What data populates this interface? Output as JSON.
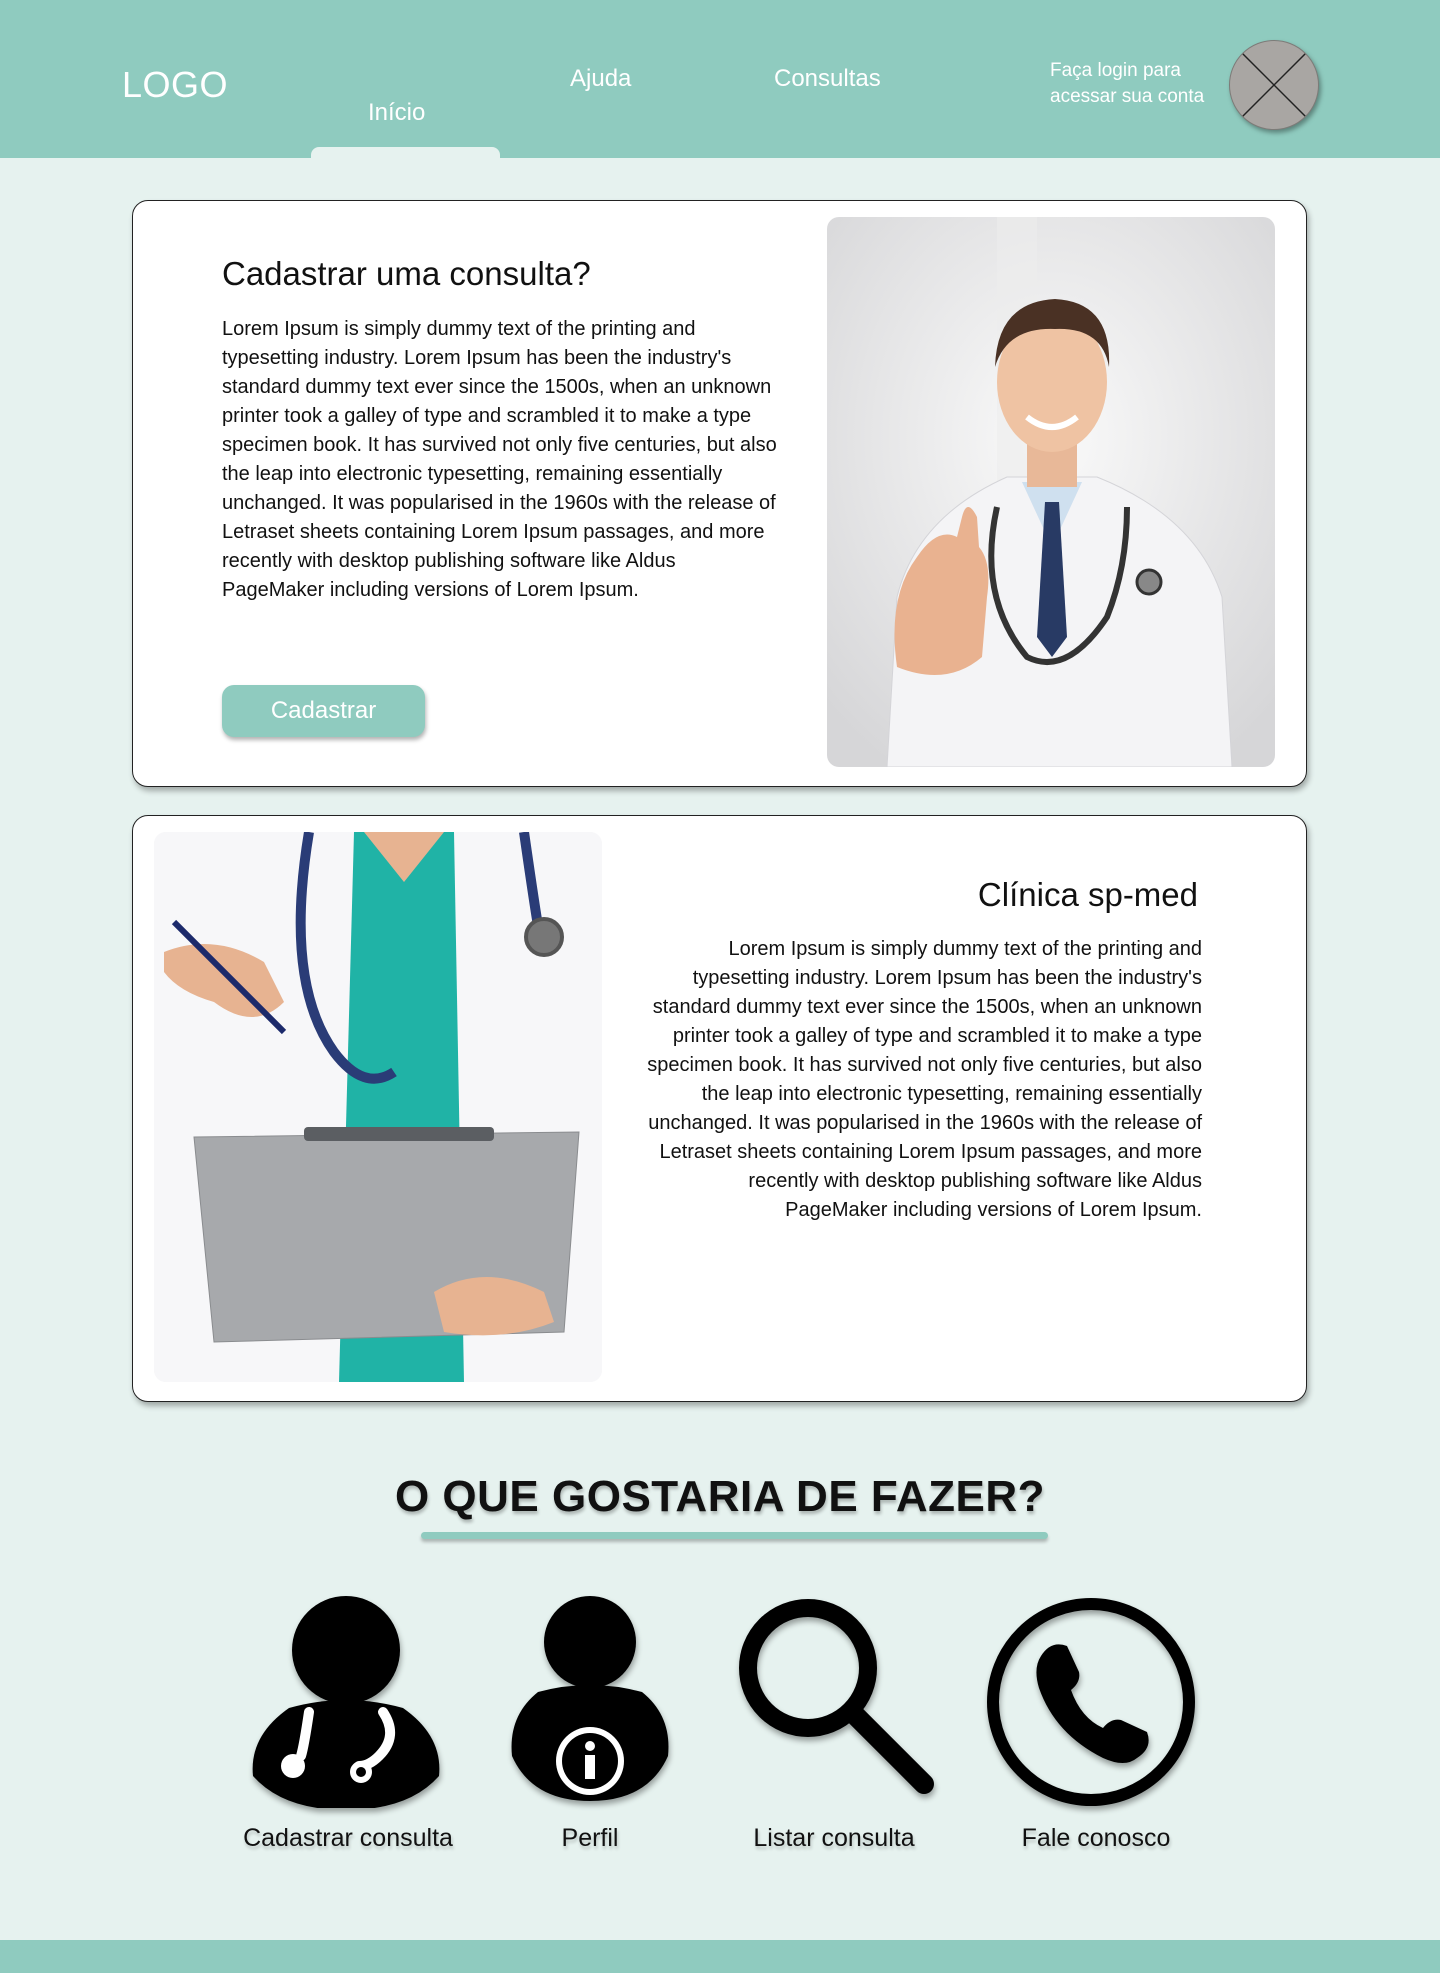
{
  "header": {
    "logo": "LOGO",
    "nav": [
      "Início",
      "Ajuda",
      "Consultas"
    ],
    "active_nav": "Início",
    "login_text": "Faça login para acessar sua conta"
  },
  "card1": {
    "title": "Cadastrar uma consulta?",
    "text": "Lorem Ipsum is simply dummy text of the printing and typesetting industry. Lorem Ipsum has been the industry's standard dummy text ever since the 1500s, when an unknown printer took a galley of type and scrambled it to make a type specimen book. It has survived not only five centuries, but also the leap into electronic typesetting, remaining essentially unchanged. It was popularised in the 1960s with the release of Letraset sheets containing Lorem Ipsum passages, and more recently with desktop publishing software like Aldus PageMaker including versions of Lorem Ipsum.",
    "button": "Cadastrar"
  },
  "card2": {
    "title": "Clínica sp-med",
    "text": "Lorem Ipsum is simply dummy text of the printing and typesetting industry. Lorem Ipsum has been the industry's standard dummy text ever since the 1500s, when an unknown printer took a galley of type and scrambled it to make a type specimen book. It has survived not only five centuries, but also the leap into electronic typesetting, remaining essentially unchanged. It was popularised in the 1960s with the release of Letraset sheets containing Lorem Ipsum passages, and more recently with desktop publishing software like Aldus PageMaker including versions of Lorem Ipsum."
  },
  "section": {
    "title": "O QUE GOSTARIA DE FAZER?",
    "actions": [
      {
        "label": "Cadastrar consulta",
        "icon": "doctor-icon"
      },
      {
        "label": "Perfil",
        "icon": "user-info-icon"
      },
      {
        "label": "Listar consulta",
        "icon": "search-icon"
      },
      {
        "label": "Fale conosco",
        "icon": "phone-icon"
      }
    ]
  },
  "colors": {
    "accent": "#8fcbbf",
    "background": "#e6f2ef",
    "card": "#ffffff"
  }
}
